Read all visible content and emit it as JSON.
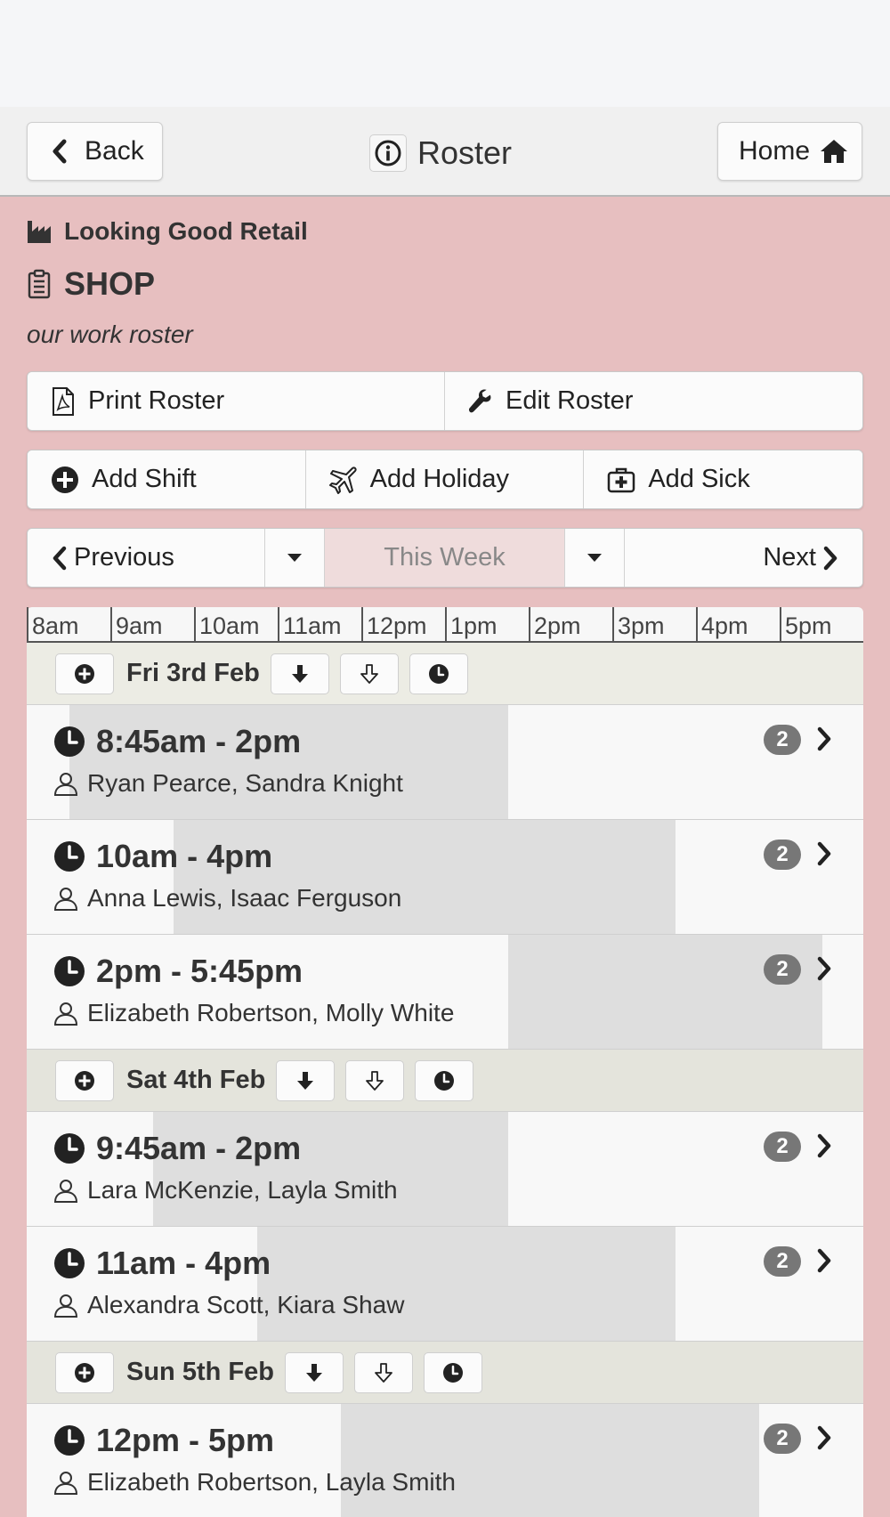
{
  "navbar": {
    "back_label": "Back",
    "title": "Roster",
    "home_label": "Home"
  },
  "header": {
    "organisation": "Looking Good Retail",
    "team": "SHOP",
    "description": "our work roster"
  },
  "actions": {
    "print_label": "Print Roster",
    "edit_label": "Edit Roster",
    "add_shift_label": "Add Shift",
    "add_holiday_label": "Add Holiday",
    "add_sick_label": "Add Sick"
  },
  "week_nav": {
    "previous_label": "Previous",
    "current_label": "This Week",
    "next_label": "Next"
  },
  "timeline": {
    "hours": [
      "8am",
      "9am",
      "10am",
      "11am",
      "12pm",
      "1pm",
      "2pm",
      "3pm",
      "4pm",
      "5pm"
    ]
  },
  "days": [
    {
      "label": "Fri 3rd Feb",
      "shifts": [
        {
          "time": "8:45am - 2pm",
          "staff": "Ryan Pearce, Sandra Knight",
          "count": "2",
          "start": 8.75,
          "end": 14
        },
        {
          "time": "10am - 4pm",
          "staff": "Anna Lewis, Isaac Ferguson",
          "count": "2",
          "start": 10,
          "end": 16
        },
        {
          "time": "2pm - 5:45pm",
          "staff": "Elizabeth Robertson, Molly White",
          "count": "2",
          "start": 14,
          "end": 17.75
        }
      ]
    },
    {
      "label": "Sat 4th Feb",
      "shifts": [
        {
          "time": "9:45am - 2pm",
          "staff": "Lara McKenzie, Layla Smith",
          "count": "2",
          "start": 9.75,
          "end": 14
        },
        {
          "time": "11am - 4pm",
          "staff": "Alexandra Scott, Kiara Shaw",
          "count": "2",
          "start": 11,
          "end": 16
        }
      ]
    },
    {
      "label": "Sun 5th Feb",
      "shifts": [
        {
          "time": "12pm - 5pm",
          "staff": "Elizabeth Robertson, Layla Smith",
          "count": "2",
          "start": 12,
          "end": 17
        }
      ]
    }
  ],
  "colors": {
    "page_background": "#e7bfc0",
    "shift_bar": "#dedede",
    "badge": "#777777"
  }
}
